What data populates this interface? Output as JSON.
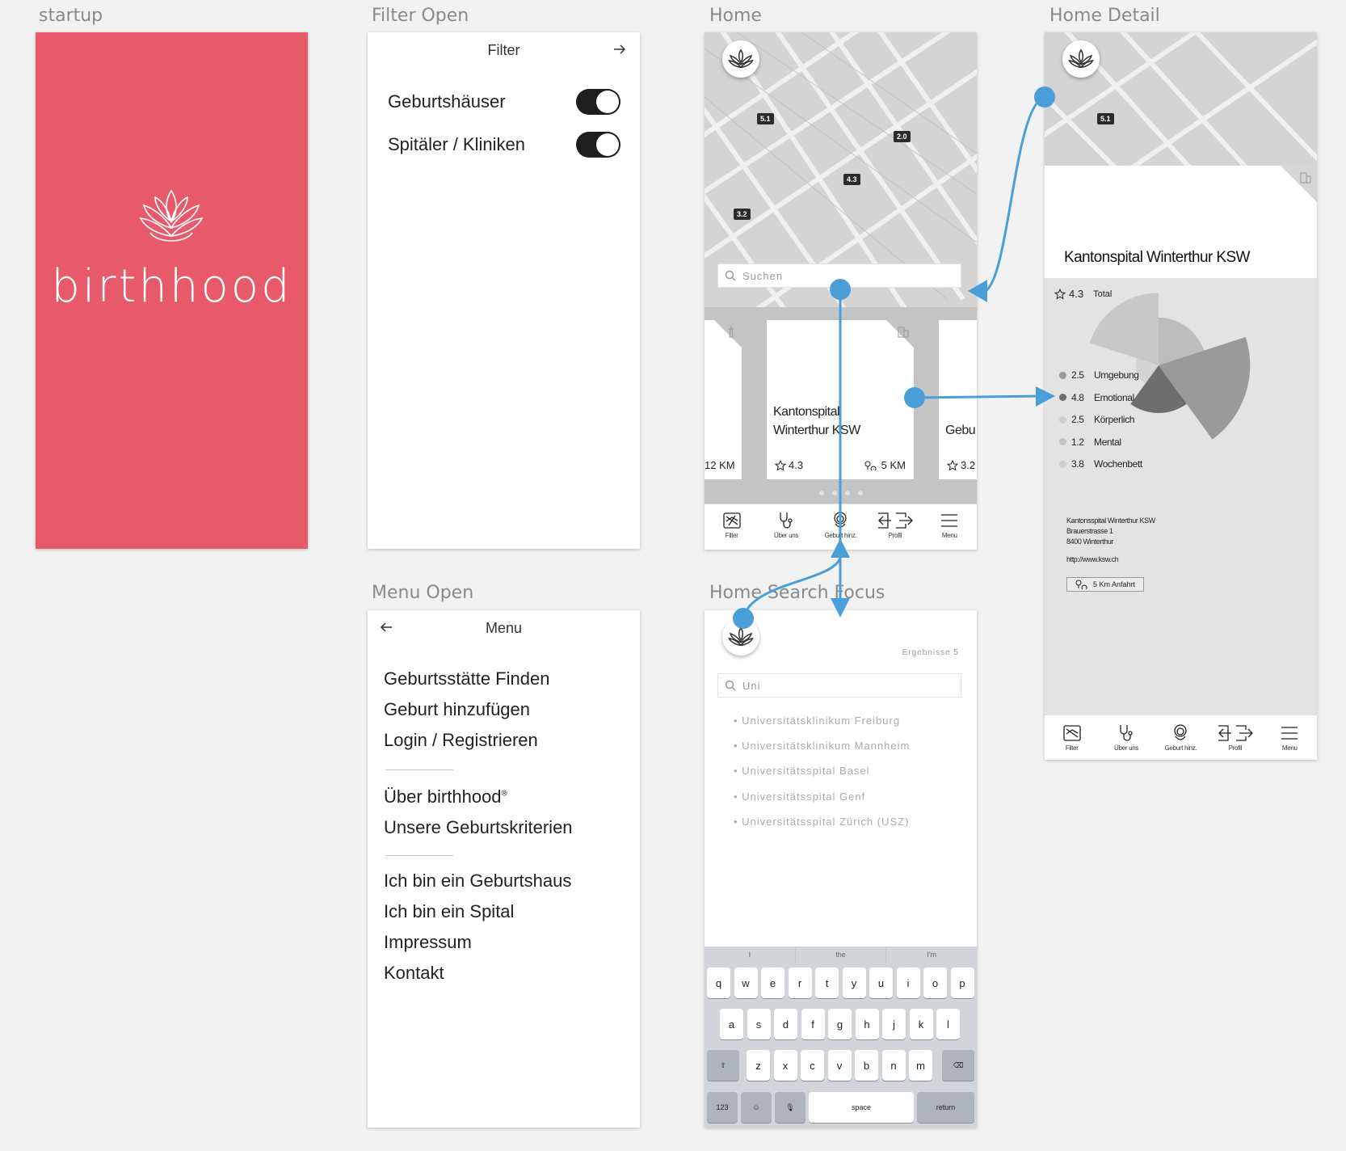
{
  "artboards": {
    "startup": "startup",
    "filter": "Filter Open",
    "home": "Home",
    "detail": "Home Detail",
    "menu": "Menu Open",
    "search": "Home Search Focus"
  },
  "startup": {
    "brand": "birthhood",
    "bg_color": "#e85a6a"
  },
  "filter": {
    "title": "Filter",
    "toggles": [
      {
        "label": "Geburtshäuser",
        "on": true
      },
      {
        "label": "Spitäler / Kliniken",
        "on": true
      }
    ]
  },
  "menu": {
    "title": "Menu",
    "groups": [
      [
        "Geburtsstätte Finden",
        "Geburt hinzufügen",
        "Login / Registrieren"
      ],
      [
        "Über birthhood",
        "Unsere Geburtskriterien"
      ],
      [
        "Ich bin ein Geburtshaus",
        "Ich bin ein Spital",
        "Impressum",
        "Kontakt"
      ]
    ],
    "trademark": "®"
  },
  "home": {
    "map_pins": [
      "5.1",
      "2.0",
      "4.3",
      "3.2"
    ],
    "search_placeholder": "Suchen",
    "cards": [
      {
        "distance": "12 KM"
      },
      {
        "name_line1": "Kantonspital",
        "name_line2": "Winterthur KSW",
        "rating": "4.3",
        "distance": "5 KM"
      },
      {
        "name_partial": "Gebu",
        "rating": "3.2"
      }
    ]
  },
  "tabbar": [
    "Filter",
    "Über uns",
    "Geburt hinz.",
    "Profil",
    "Menu"
  ],
  "search": {
    "query": "Uni",
    "results_label": "Ergebnisse 5",
    "results": [
      "Universitätsklinikum Freiburg",
      "Universitätsklinikum Mannheim",
      "Universitätsspital Basel",
      "Universitätsspital Genf",
      "Universitätsspital Zürich (USZ)"
    ],
    "keyboard": {
      "suggestions": [
        "I",
        "the",
        "I'm"
      ],
      "row1": [
        "q",
        "w",
        "e",
        "r",
        "t",
        "y",
        "u",
        "i",
        "o",
        "p"
      ],
      "row2": [
        "a",
        "s",
        "d",
        "f",
        "g",
        "h",
        "j",
        "k",
        "l"
      ],
      "row3": [
        "z",
        "x",
        "c",
        "v",
        "b",
        "n",
        "m"
      ],
      "num": "123",
      "space": "space",
      "return": "return"
    }
  },
  "detail": {
    "map_pin": "5.1",
    "title": "Kantonspital Winterthur KSW",
    "total_rating": "4.3",
    "total_label": "Total",
    "categories": [
      {
        "value": "2.5",
        "label": "Umgebung",
        "color": "#9a9a9a"
      },
      {
        "value": "4.8",
        "label": "Emotional",
        "color": "#6e6e6e"
      },
      {
        "value": "2.5",
        "label": "Körperlich",
        "color": "#cfcfcf"
      },
      {
        "value": "1.2",
        "label": "Mental",
        "color": "#c4c4c4"
      },
      {
        "value": "3.8",
        "label": "Wochenbett",
        "color": "#cfcfcf"
      }
    ],
    "address": [
      "Kantonsspital Winterthur KSW",
      "Brauerstrasse 1",
      "8400 Winterthur"
    ],
    "url": "http://www.ksw.ch",
    "route": "5 Km Anfahrt"
  },
  "colors": {
    "flow": "#4a9fd8",
    "brand": "#e85a6a"
  }
}
